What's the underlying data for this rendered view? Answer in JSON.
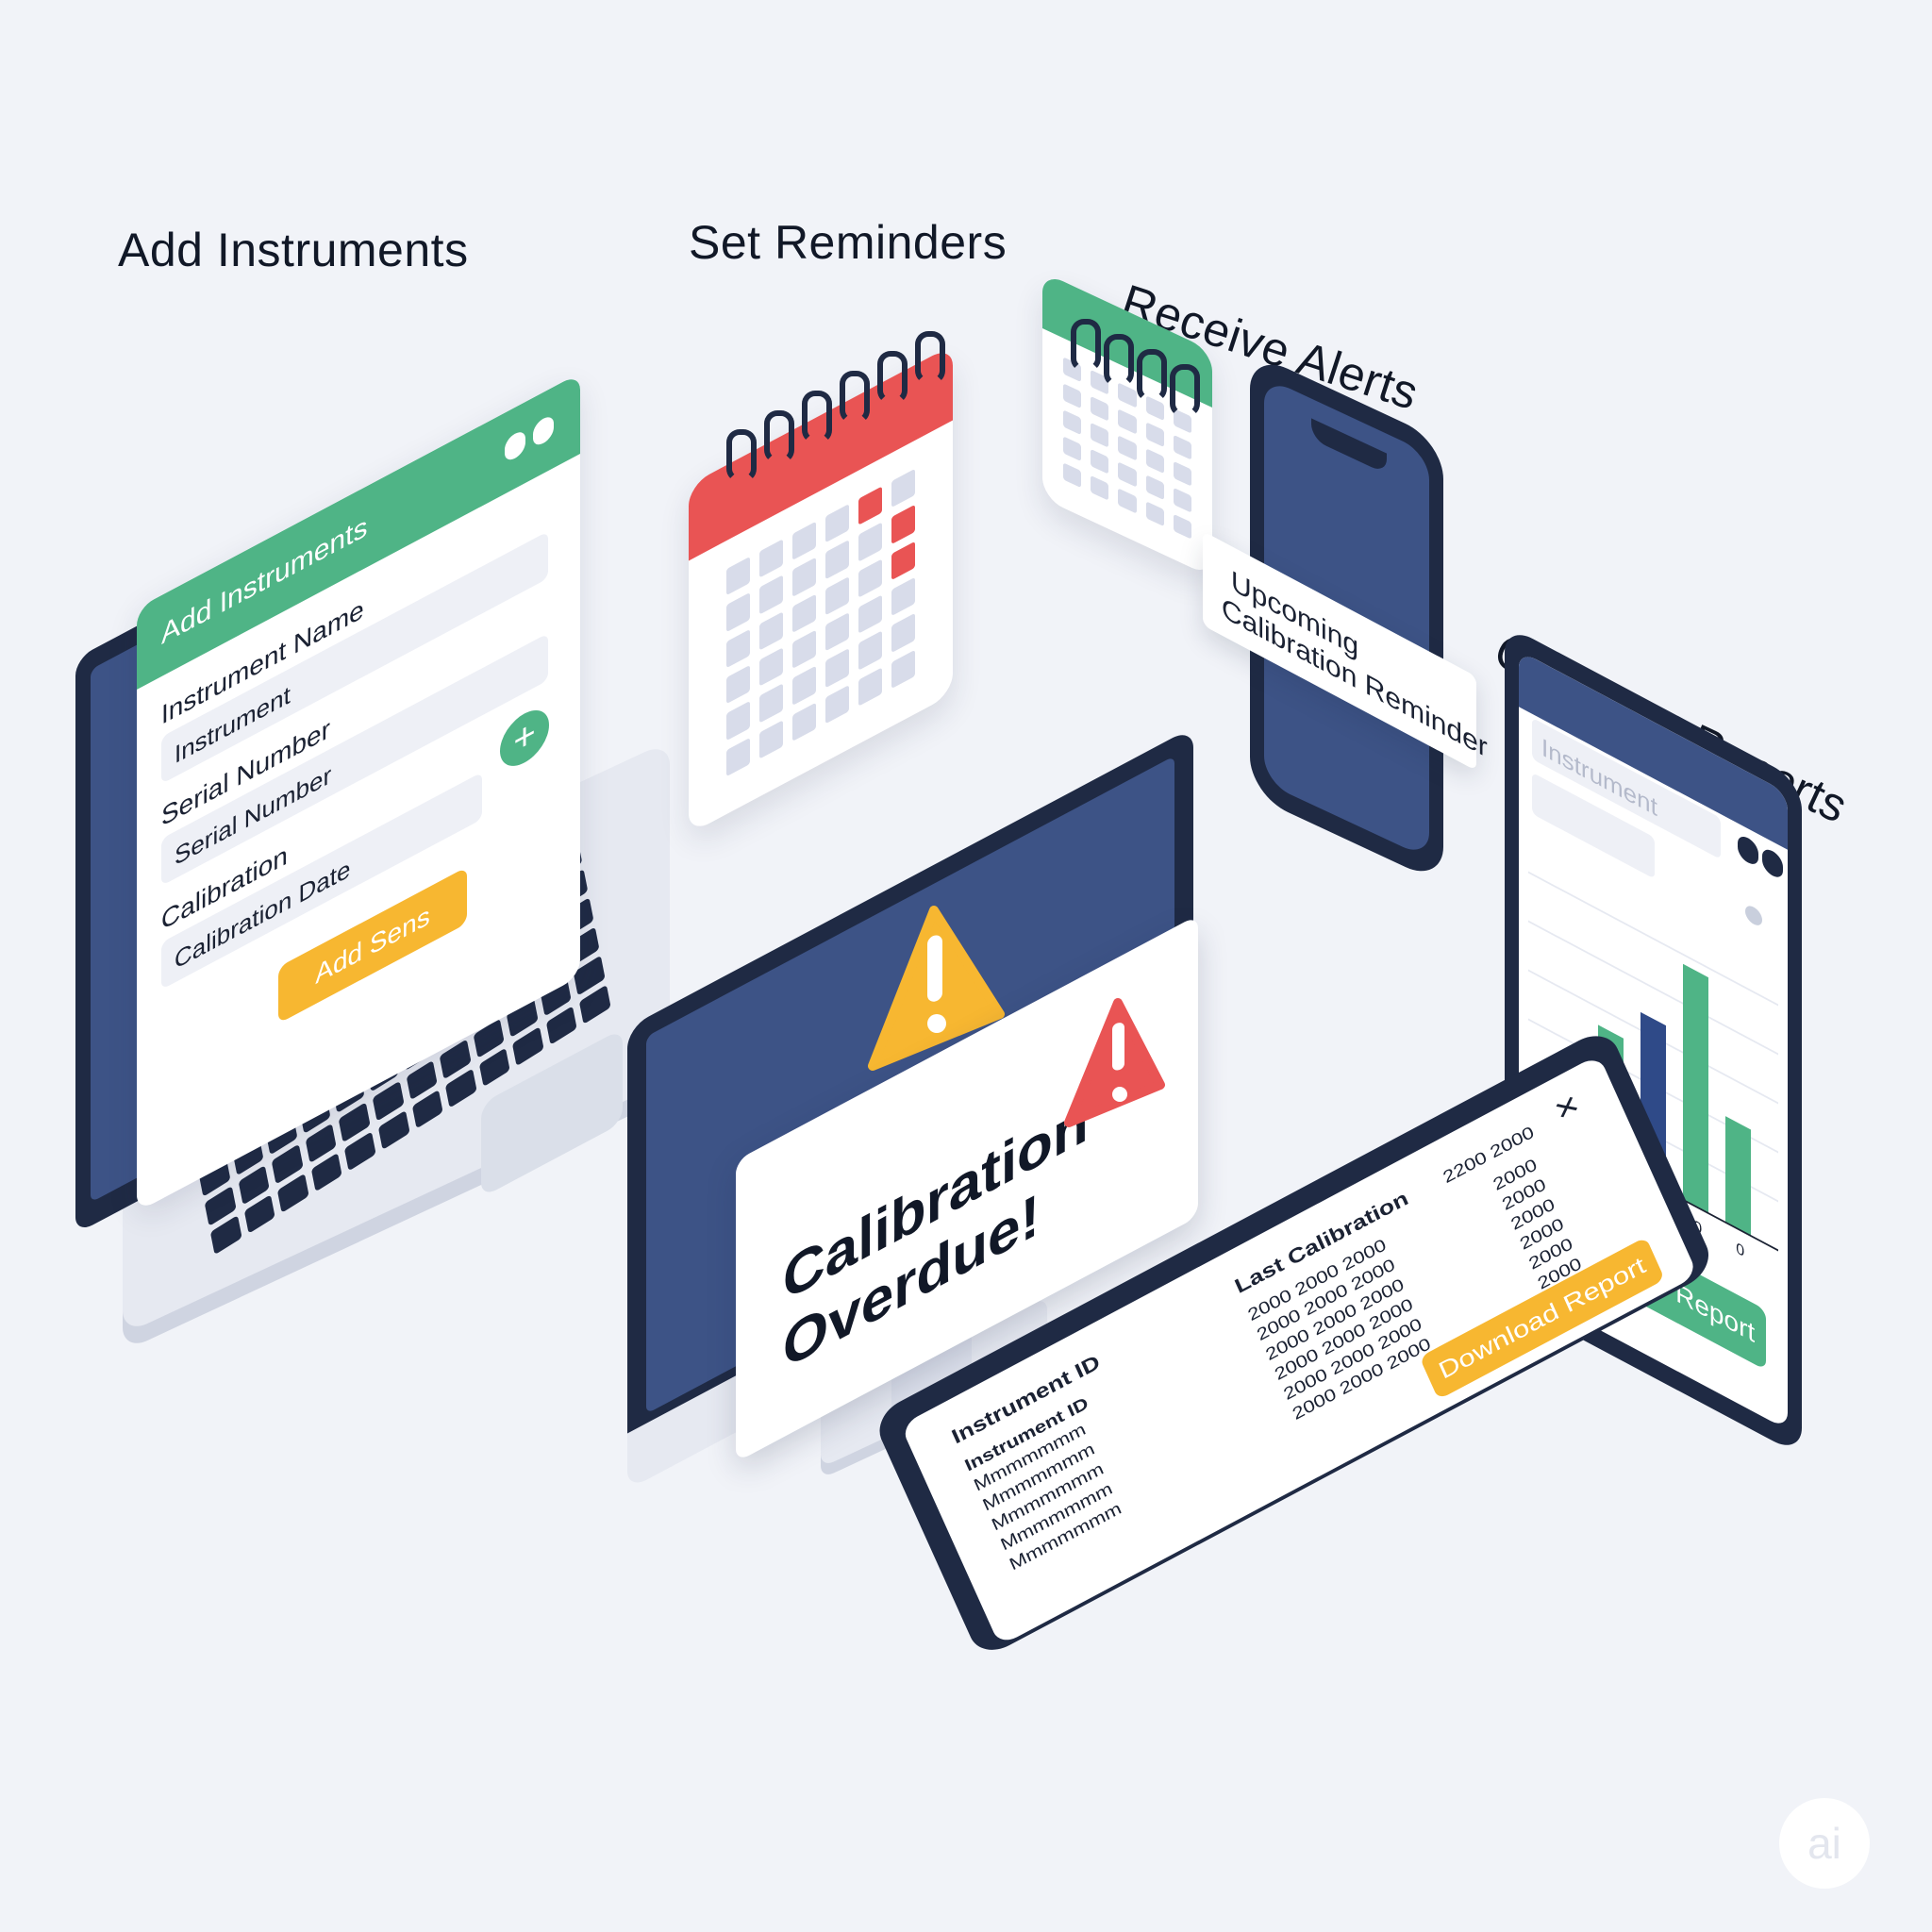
{
  "sections": {
    "add_instruments": "Add Instruments",
    "set_reminders": "Set Reminders",
    "receive_alerts": "Receive Alerts",
    "generate_reports": "Generate Reports"
  },
  "laptop_form": {
    "header_title": "Add Instruments",
    "instrument_name_label": "Instrument Name",
    "instrument_value": "Instrument",
    "serial_number_label": "Serial Number",
    "serial_number_value": "Serial Number",
    "calibration_label": "Calibration",
    "calibration_date_label": "Calibration Date",
    "add_icon": "plus-icon",
    "submit_label": "Add Sens"
  },
  "phone_notification": {
    "line1": "Upcoming",
    "line2": "Calibration Reminder"
  },
  "monitor_alert": {
    "line1": "Calibration",
    "line2": "Overdue!",
    "icon": "warning-icon"
  },
  "report_tablet": {
    "search_placeholder": "Instrument",
    "download_label": "Download Report"
  },
  "chart_data": {
    "type": "bar",
    "categories": [
      "0",
      "0",
      "0",
      "0",
      "0"
    ],
    "series": [
      {
        "values": [
          30,
          55,
          70,
          100,
          45
        ]
      }
    ],
    "colors": [
      "#2f4a88",
      "#4fb486",
      "#2f4a88",
      "#4fb486",
      "#4fb486"
    ]
  },
  "table_tablet": {
    "close_icon": "close-icon",
    "columns": [
      "Instrument ID",
      "Last Calibration"
    ],
    "header_extra": "2200 2000",
    "rows": [
      {
        "id": "Instrument ID",
        "date": "2000 2000 2000",
        "value": "2000"
      },
      {
        "id": "Mmmmmmm",
        "date": "2000 2000 2000",
        "value": "2000"
      },
      {
        "id": "Mmmmmmm",
        "date": "2000 2000 2000",
        "value": "2000"
      },
      {
        "id": "Mmmmmmm",
        "date": "2000 2000 2000",
        "value": "2000"
      },
      {
        "id": "Mmmmmmm",
        "date": "2000 2000 2000",
        "value": "2000"
      },
      {
        "id": "Mmmmmmm",
        "date": "2000 2000 2000",
        "value": "2000"
      }
    ],
    "download_label": "Download Report"
  },
  "watermark": "ai"
}
